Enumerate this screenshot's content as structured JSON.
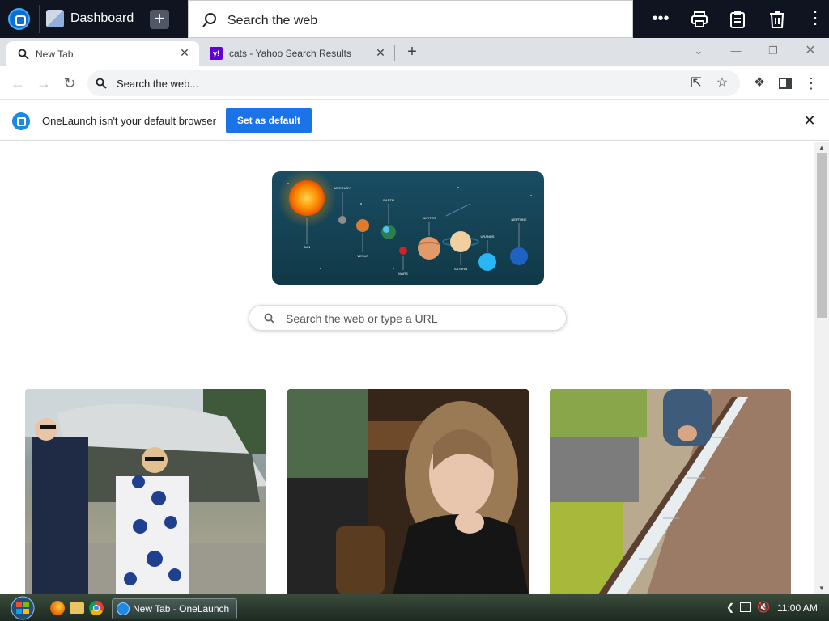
{
  "onelaunch_bar": {
    "dashboard_label": "Dashboard",
    "search_placeholder": "Search the web",
    "buttons": [
      "more-icon",
      "print-icon",
      "clipboard-icon",
      "trash-icon",
      "kebab-icon"
    ]
  },
  "tabs": [
    {
      "label": "New Tab",
      "active": true
    },
    {
      "label": "cats - Yahoo Search Results",
      "active": false
    }
  ],
  "toolbar": {
    "address_placeholder": "Search the web..."
  },
  "infobar": {
    "message": "OneLaunch isn't your default browser",
    "button_label": "Set as default"
  },
  "page": {
    "search_placeholder": "Search the web or type a URL",
    "banner_labels": [
      "SUN",
      "MERCURY",
      "VENUS",
      "EARTH",
      "MARS",
      "JUPITER",
      "SATURN",
      "URANUS",
      "NEPTUNE"
    ]
  },
  "taskbar": {
    "task_label": "New Tab - OneLaunch",
    "clock": "11:00 AM"
  },
  "colors": {
    "onelaunch_bar": "#0f1420",
    "accent": "#1a73e8",
    "tabstrip": "#dee1e6"
  }
}
